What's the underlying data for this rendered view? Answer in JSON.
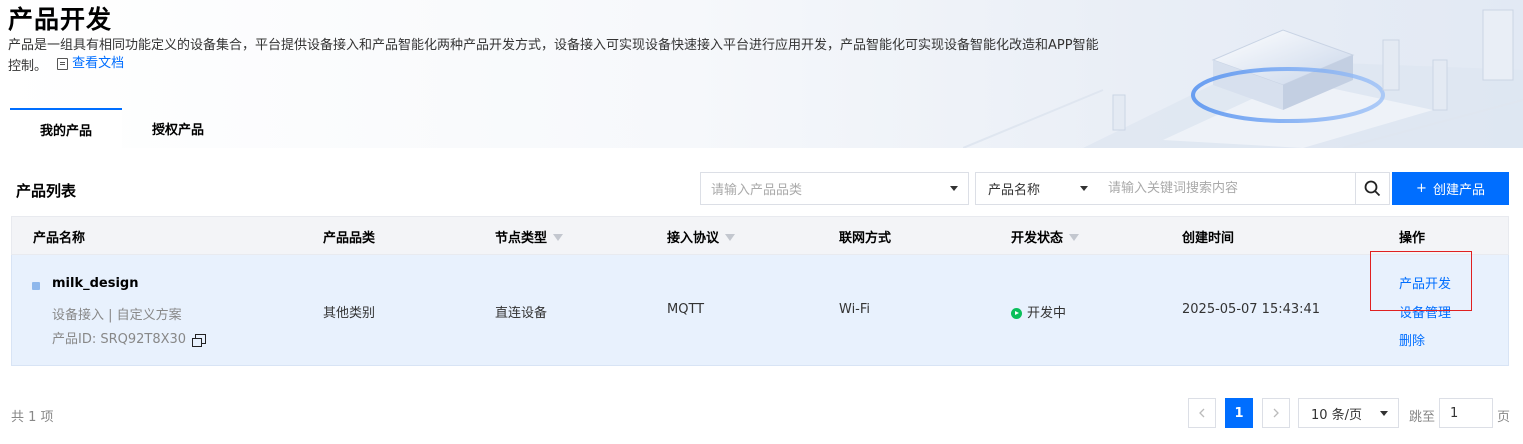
{
  "header": {
    "title": "产品开发",
    "description": "产品是一组具有相同功能定义的设备集合，平台提供设备接入和产品智能化两种产品开发方式，设备接入可实现设备快速接入平台进行应用开发，产品智能化可实现设备智能化改造和APP智能控制。",
    "doc_link": "查看文档"
  },
  "tabs": [
    {
      "label": "我的产品",
      "active": true
    },
    {
      "label": "授权产品",
      "active": false
    }
  ],
  "toolbar": {
    "section_title": "产品列表",
    "category_placeholder": "请输入产品品类",
    "field_select": "产品名称",
    "keyword_placeholder": "请输入关键词搜索内容",
    "create_label": "创建产品",
    "create_icon": "+"
  },
  "table": {
    "columns": [
      "产品名称",
      "产品品类",
      "节点类型",
      "接入协议",
      "联网方式",
      "开发状态",
      "创建时间",
      "操作"
    ],
    "rows": [
      {
        "name": "milk_design",
        "access_info": "设备接入 | 自定义方案",
        "product_id": "产品ID:  SRQ92T8X30",
        "category": "其他类别",
        "node_type": "直连设备",
        "protocol": "MQTT",
        "network": "Wi-Fi",
        "status": "开发中",
        "created": "2025-05-07 15:43:41",
        "actions": [
          "产品开发",
          "设备管理",
          "删除"
        ]
      }
    ]
  },
  "pagination": {
    "total": "共 1 项",
    "current_page": "1",
    "page_size": "10 条/页",
    "jump_label": "跳至",
    "jump_value": "1",
    "page_suffix": "页"
  },
  "colors": {
    "accent": "#006eff",
    "status_green": "#0abf5b",
    "highlight_red": "#e02020",
    "row_bg": "#e8f1fd"
  }
}
